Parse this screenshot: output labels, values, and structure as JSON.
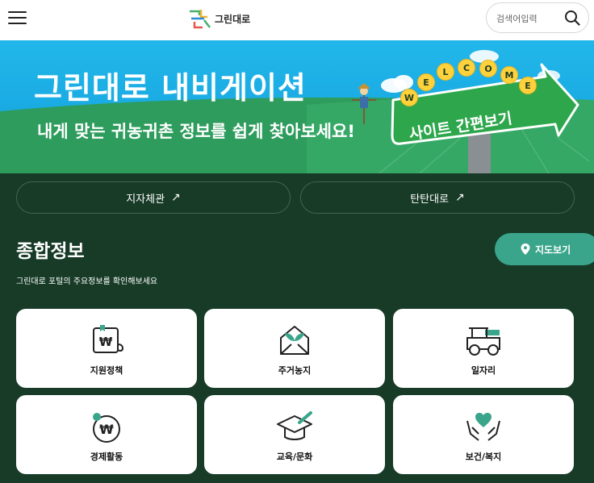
{
  "header": {
    "logo_text": "그린대로",
    "search_placeholder": "검색어입력"
  },
  "banner": {
    "title": "그린대로 내비게이션",
    "subtitle": "내게 맞는 귀농귀촌 정보를 쉽게 찾아보세요!",
    "welcome_letters": [
      "W",
      "E",
      "L",
      "C",
      "O",
      "M",
      "E"
    ],
    "sign_text": "사이트 간편보기"
  },
  "shortcuts": [
    {
      "label": "지자체관",
      "arrow": "↗"
    },
    {
      "label": "탄탄대로",
      "arrow": "↗"
    }
  ],
  "section": {
    "title": "종합정보",
    "description": "그린대로 포털의 주요정보를 확인해보세요",
    "map_button": "지도보기"
  },
  "cards": [
    {
      "label": "지원정책",
      "icon": "support-policy-icon"
    },
    {
      "label": "주거농지",
      "icon": "housing-farmland-icon"
    },
    {
      "label": "일자리",
      "icon": "jobs-icon"
    },
    {
      "label": "경제활동",
      "icon": "economic-activity-icon"
    },
    {
      "label": "교육/문화",
      "icon": "education-culture-icon"
    },
    {
      "label": "보건/복지",
      "icon": "health-welfare-icon"
    }
  ],
  "colors": {
    "page_bg": "#173b27",
    "banner_sky": "#22b7ea",
    "accent_green": "#3aa58b",
    "sign_green": "#2ea74c",
    "welcome_yellow": "#ffd23c"
  }
}
